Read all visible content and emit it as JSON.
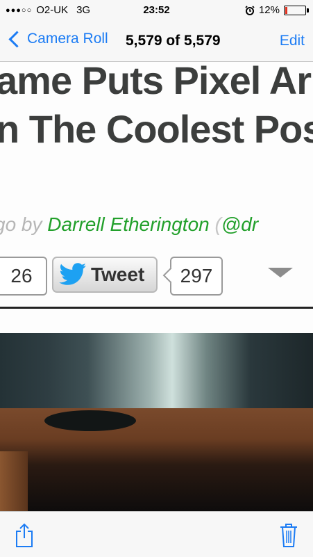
{
  "status": {
    "carrier": "O2-UK",
    "network": "3G",
    "time": "23:52",
    "battery": "12%",
    "signal_dots": "●●●○○"
  },
  "nav": {
    "back_label": "Camera Roll",
    "title": "5,579 of 5,579",
    "edit_label": "Edit"
  },
  "article": {
    "headline_line1": "ame Puts Pixel Ar",
    "headline_line2": "n The Coolest Pos",
    "byline_prefix": "go by ",
    "byline_author": "Darrell Etherington",
    "byline_paren": " (",
    "byline_handle": "@dr"
  },
  "social": {
    "count_left": "26",
    "tweet_label": "Tweet",
    "tweet_count": "297"
  },
  "colors": {
    "accent": "#1c7cf4",
    "author_green": "#22a02b",
    "twitter_blue": "#1da1f2",
    "battery_red": "#e0311f"
  },
  "icons": [
    "back-chevron-icon",
    "alarm-icon",
    "battery-icon",
    "twitter-bird-icon",
    "dropdown-triangle-icon",
    "share-icon",
    "trash-icon"
  ]
}
